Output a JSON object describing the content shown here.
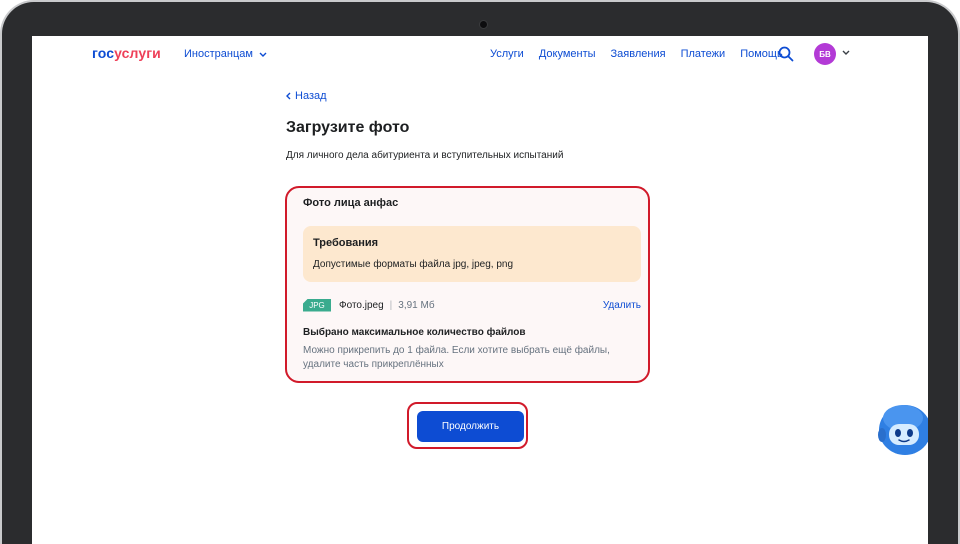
{
  "header": {
    "logo_part1": "гос",
    "logo_part2": "услуги",
    "lang_label": "Иностранцам",
    "nav": [
      "Услуги",
      "Документы",
      "Заявления",
      "Платежи",
      "Помощь"
    ],
    "avatar_initials": "БВ"
  },
  "page": {
    "back_label": "Назад",
    "title": "Загрузите фото",
    "subtitle": "Для личного дела абитуриента и вступительных испытаний"
  },
  "upload": {
    "section_title": "Фото лица анфас",
    "requirements_title": "Требования",
    "requirements_text": "Допустимые форматы файла jpg, jpeg, png",
    "file": {
      "type_badge": "JPG",
      "name": "Фото.jpeg",
      "separator": "|",
      "size": "3,91 Мб",
      "delete_label": "Удалить"
    },
    "max_title": "Выбрано максимальное количество файлов",
    "max_text": "Можно прикрепить до 1 файла. Если хотите выбрать ещё файлы, удалите часть прикреплённых"
  },
  "actions": {
    "continue_label": "Продолжить"
  },
  "colors": {
    "brand_blue": "#0d4cd3",
    "brand_red": "#ee3f58",
    "highlight_red": "#d11a2a",
    "requirements_bg": "#fde8cf",
    "jpg_badge": "#3aab8e",
    "avatar": "#b33ad6"
  },
  "icons": [
    "chevron-down-icon",
    "chevron-left-icon",
    "search-icon",
    "assistant-robot-icon"
  ]
}
